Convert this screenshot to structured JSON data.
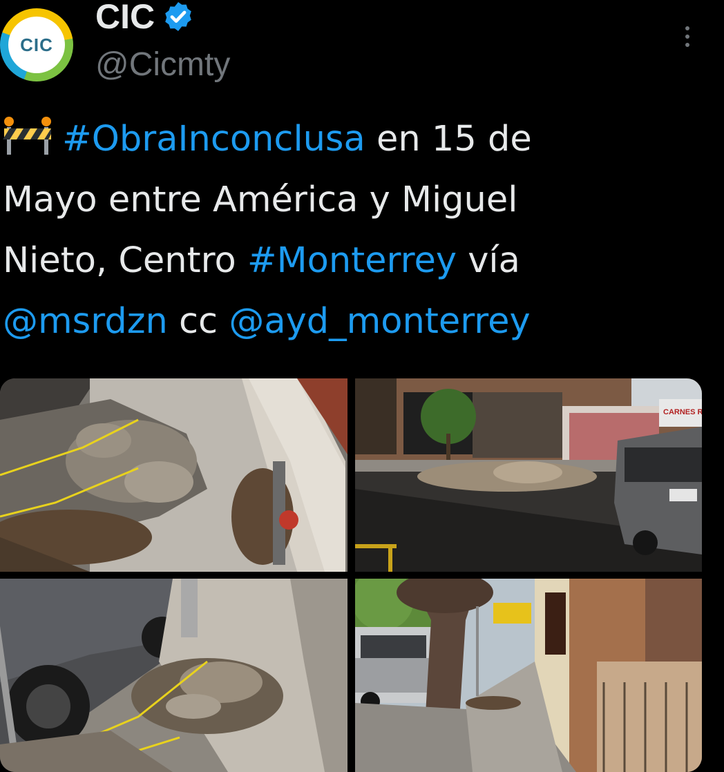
{
  "account": {
    "avatar_text": "CIC",
    "name": "CIC",
    "handle": "@Cicmty",
    "verified_icon": "verified-badge-icon",
    "menu_icon": "more-vertical-icon"
  },
  "tweet": {
    "emoji": "construction-barrier-emoji",
    "hashtag1": "#ObraInconclusa",
    "text1": " en 15 de",
    "line2": "Mayo entre América y Miguel",
    "text3": "Nieto, Centro ",
    "hashtag2": "#Monterrey",
    "text3b": " vía",
    "mention1": "@msrdzn",
    "text4": " cc ",
    "mention2": "@ayd_monterrey"
  },
  "media": {
    "photo1": "sidewalk-rubble-photo",
    "photo2": "street-dirt-pile-photo",
    "photo3": "sidewalk-rubble-car-photo",
    "photo4": "tree-sidewalk-photo",
    "sign_text": "CARNES RAMOS"
  },
  "colors": {
    "link": "#1d9bf0",
    "background": "#000000",
    "text": "#e7e9ea",
    "muted": "#71767b"
  }
}
